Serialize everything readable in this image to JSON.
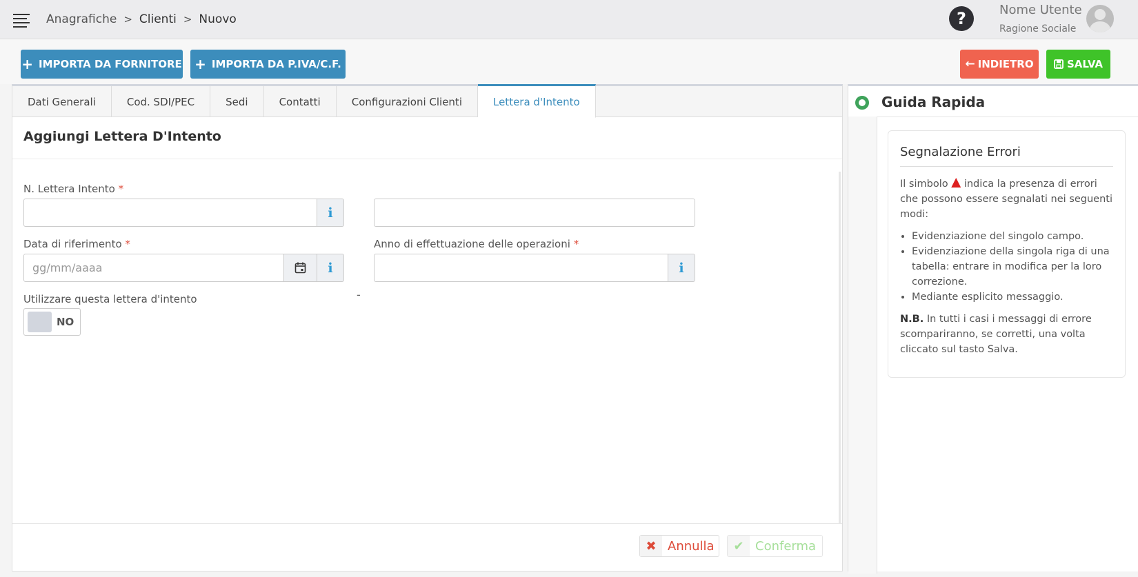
{
  "header": {
    "breadcrumb": [
      "Anagrafiche",
      "Clienti",
      "Nuovo"
    ],
    "breadcrumb_sep": ">",
    "help_label": "?",
    "user_name": "Nome Utente",
    "user_company": "Ragione Sociale"
  },
  "toolbar": {
    "import_supplier_label": "IMPORTA DA FORNITORE",
    "import_piva_label": "IMPORTA DA P.IVA/C.F.",
    "back_label": "INDIETRO",
    "save_label": "SALVA",
    "plus_glyph": "+",
    "back_glyph": "←"
  },
  "tabs": [
    {
      "label": "Dati Generali"
    },
    {
      "label": "Cod. SDI/PEC"
    },
    {
      "label": "Sedi"
    },
    {
      "label": "Contatti"
    },
    {
      "label": "Configurazioni Clienti"
    },
    {
      "label": "Lettera d'Intento",
      "active": true
    }
  ],
  "form": {
    "title": "Aggiungi Lettera D'Intento",
    "n_lettera_label": "N. Lettera Intento",
    "n_lettera_value": "",
    "n_lettera_suffix_value": "",
    "dash": "-",
    "data_rif_label": "Data di riferimento",
    "data_rif_placeholder": "gg/mm/aaaa",
    "anno_label": "Anno di effettuazione delle operazioni",
    "anno_value": "",
    "utilizzare_label": "Utilizzare questa lettera d'intento",
    "toggle_text": "NO",
    "required_mark": "*",
    "info_glyph": "i",
    "cancel_label": "Annulla",
    "confirm_label": "Conferma",
    "cancel_glyph": "✖",
    "confirm_glyph": "✔"
  },
  "help": {
    "title": "Guida Rapida",
    "box_title": "Segnalazione Errori",
    "intro_before": "Il simbolo",
    "intro_after": "indica la presenza di errori che possono essere segnalati nei seguenti modi:",
    "items": [
      "Evidenziazione del singolo campo.",
      "Evidenziazione della singola riga di una tabella: entrare in modifica per la loro correzione.",
      "Mediante esplicito messaggio."
    ],
    "nb_label": "N.B.",
    "nb_text": "In tutti i casi i messaggi di errore scompariranno, se corretti, una volta cliccato sul tasto Salva."
  },
  "colors": {
    "primary": "#3c8dbc",
    "danger": "#f0634f",
    "success": "#3fc329",
    "required": "#dd4b39"
  }
}
